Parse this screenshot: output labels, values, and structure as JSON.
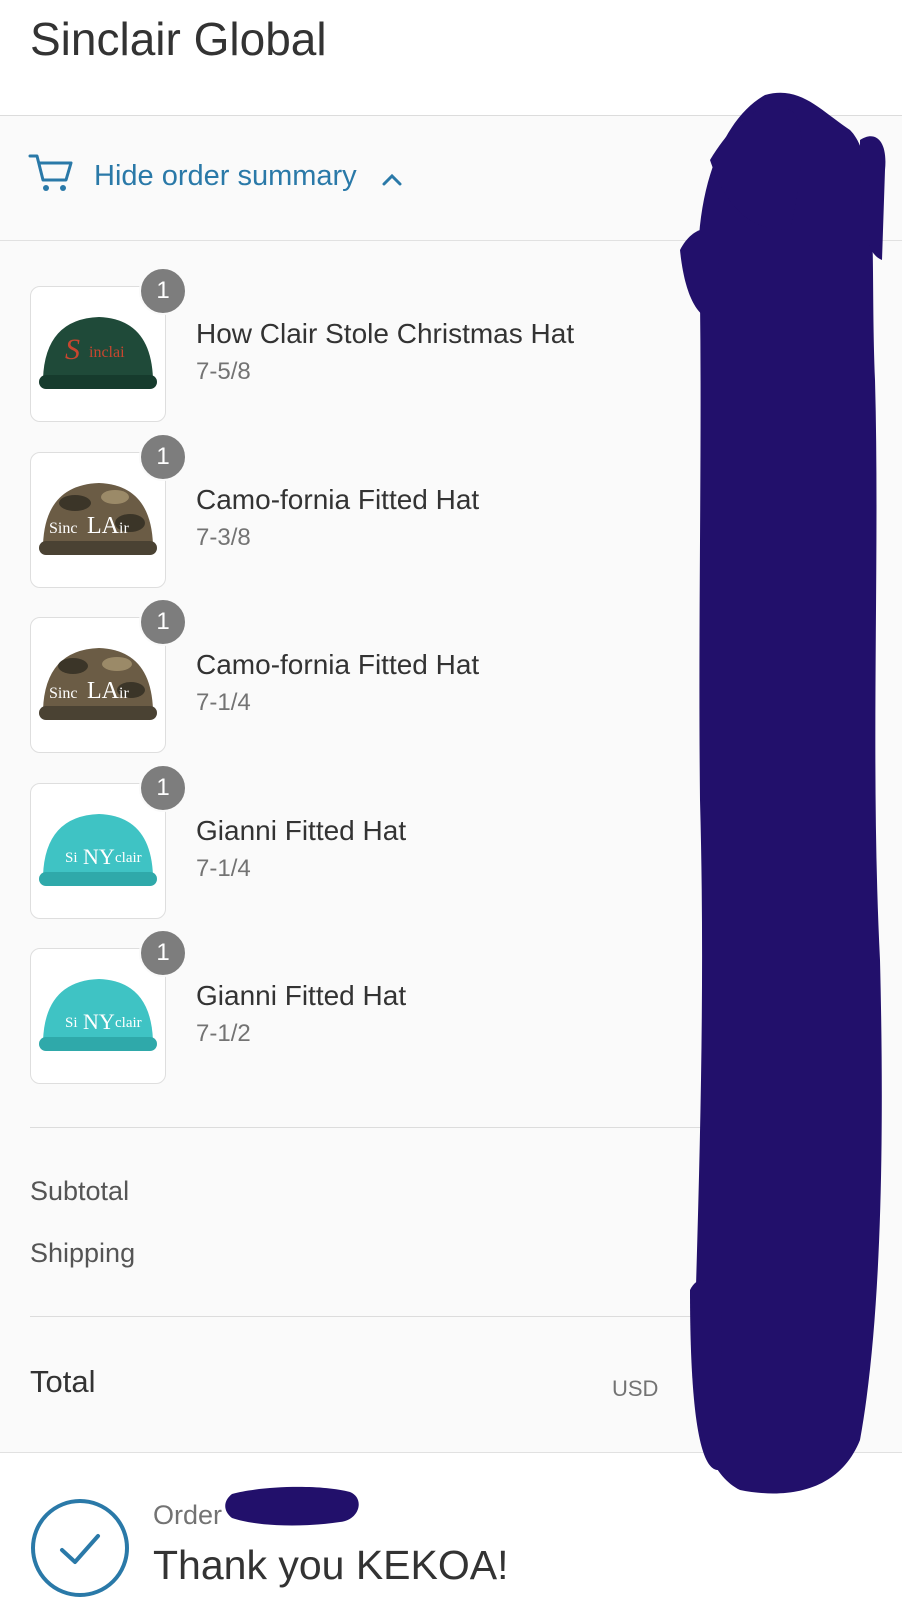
{
  "header": {
    "store_name": "Sinclair Global"
  },
  "summary_toggle": {
    "label": "Hide order summary",
    "icon": "cart-icon",
    "chevron": "chevron-up-icon"
  },
  "items": [
    {
      "name": "How Clair Stole Christmas Hat",
      "variant": "7-5/8",
      "quantity": "1",
      "image": "green-hat-image",
      "hat_color": "#1f4a39",
      "logo_color": "#c8462f",
      "logo": "Sinclair"
    },
    {
      "name": "Camo-fornia Fitted Hat",
      "variant": "7-3/8",
      "quantity": "1",
      "image": "camo-hat-image",
      "hat_color": "#6b5c45",
      "logo_color": "#ffffff",
      "logo": "Sinc LA ir"
    },
    {
      "name": "Camo-fornia Fitted Hat",
      "variant": "7-1/4",
      "quantity": "1",
      "image": "camo-hat-image",
      "hat_color": "#6b5c45",
      "logo_color": "#ffffff",
      "logo": "Sinc LA ir"
    },
    {
      "name": "Gianni Fitted Hat",
      "variant": "7-1/4",
      "quantity": "1",
      "image": "teal-hat-image",
      "hat_color": "#3fc3c4",
      "logo_color": "#ffffff",
      "logo": "Si NY clair"
    },
    {
      "name": "Gianni Fitted Hat",
      "variant": "7-1/2",
      "quantity": "1",
      "image": "teal-hat-image",
      "hat_color": "#3fc3c4",
      "logo_color": "#ffffff",
      "logo": "Si NY clair"
    }
  ],
  "totals": {
    "subtotal_label": "Subtotal",
    "shipping_label": "Shipping",
    "total_label": "Total",
    "currency": "USD"
  },
  "confirmation": {
    "order_label": "Order",
    "thank_you": "Thank you KEKOA!"
  },
  "colors": {
    "link": "#2a79a8",
    "redaction": "#22106b",
    "badge": "#7d7d7d"
  }
}
